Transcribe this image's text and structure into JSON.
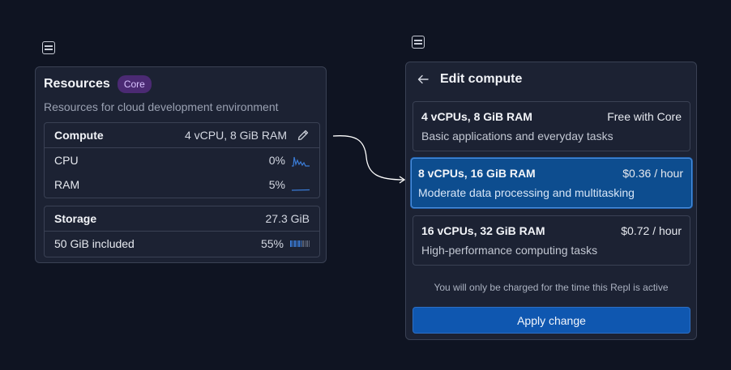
{
  "resources": {
    "title": "Resources",
    "badge": "Core",
    "description": "Resources for cloud development environment",
    "compute": {
      "label": "Compute",
      "value": "4 vCPU, 8 GiB RAM",
      "cpu": {
        "label": "CPU",
        "value": "0%"
      },
      "ram": {
        "label": "RAM",
        "value": "5%"
      }
    },
    "storage": {
      "label": "Storage",
      "value": "27.3 GiB",
      "included": {
        "label": "50 GiB included",
        "value": "55%",
        "fraction": 0.55
      }
    }
  },
  "edit": {
    "title": "Edit compute",
    "options": [
      {
        "name": "4 vCPUs, 8 GiB RAM",
        "price": "Free with Core",
        "description": "Basic applications and everyday tasks",
        "selected": false
      },
      {
        "name": "8 vCPUs, 16 GiB RAM",
        "price": "$0.36 / hour",
        "description": "Moderate data processing and multitasking",
        "selected": true
      },
      {
        "name": "16 vCPUs, 32 GiB RAM",
        "price": "$0.72 / hour",
        "description": "High-performance computing tasks",
        "selected": false
      }
    ],
    "note": "You will only be charged for the time this Repl is active",
    "apply_label": "Apply change"
  },
  "icons": {
    "left_top": "server-icon",
    "right_top": "server-icon",
    "edit": "pencil-icon",
    "back": "arrow-left-icon"
  },
  "colors": {
    "background": "#0f1422",
    "panel": "#1c2233",
    "accent": "#0f57b0",
    "selected": "#0d4d8f",
    "badge": "#4b2a73",
    "spark": "#3a7bd5"
  }
}
